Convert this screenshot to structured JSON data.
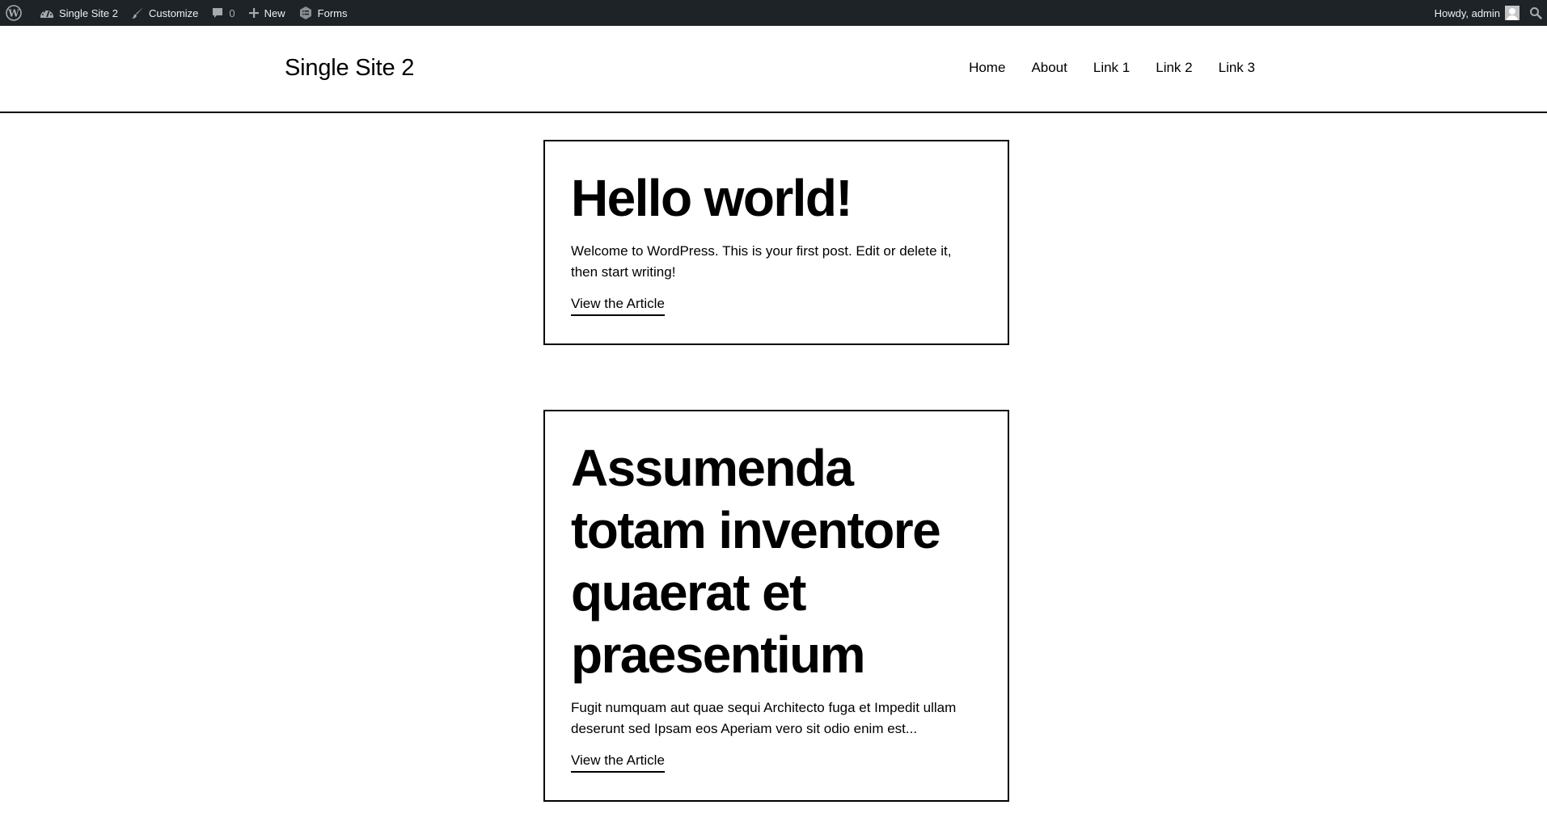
{
  "admin_bar": {
    "items": [
      {
        "icon": "wordpress-logo-icon",
        "label": ""
      },
      {
        "icon": "dashboard-icon",
        "label": "Single Site 2"
      },
      {
        "icon": "paintbrush-icon",
        "label": "Customize"
      },
      {
        "icon": "comment-icon",
        "label": "0"
      },
      {
        "icon": "plus-icon",
        "label": "New"
      },
      {
        "icon": "forms-icon",
        "label": "Forms"
      }
    ],
    "greeting": "Howdy, admin",
    "search_icon": "search-icon"
  },
  "header": {
    "site_title": "Single Site 2",
    "nav": [
      "Home",
      "About",
      "Link 1",
      "Link 2",
      "Link 3"
    ]
  },
  "posts": [
    {
      "title": "Hello world!",
      "excerpt": "Welcome to WordPress. This is your first post. Edit or delete it, then start writing!",
      "link_label": "View the Article"
    },
    {
      "title": "Assumenda totam inventore quaerat et praesentium",
      "excerpt": "Fugit numquam aut quae sequi Architecto fuga et Impedit ullam deserunt sed Ipsam eos Aperiam vero sit odio enim est...",
      "link_label": "View the Article"
    }
  ],
  "colors": {
    "admin_bar_bg": "#1d2327",
    "admin_bar_text": "#f0f0f1",
    "admin_bar_icon": "#a7aaad",
    "text": "#000000",
    "background": "#ffffff"
  }
}
